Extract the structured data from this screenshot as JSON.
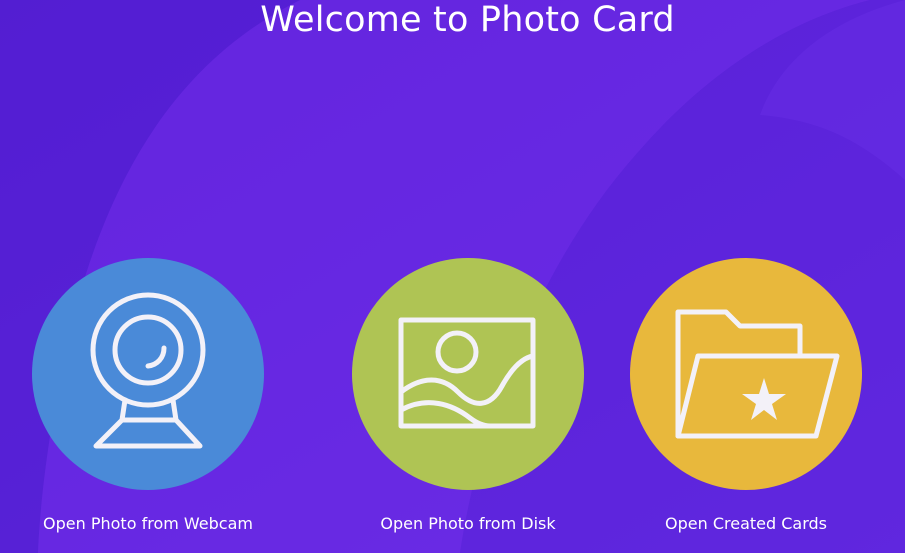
{
  "app": {
    "title": "Welcome to Photo Card"
  },
  "colors": {
    "background": "#5b22dd",
    "webcam": "#4a8ad8",
    "disk": "#afc454",
    "cards": "#e8b83c",
    "icon_stroke": "#f3f1f8"
  },
  "actions": [
    {
      "id": "webcam",
      "label": "Open Photo from Webcam",
      "icon": "webcam-icon"
    },
    {
      "id": "disk",
      "label": "Open Photo from Disk",
      "icon": "image-icon"
    },
    {
      "id": "cards",
      "label": "Open Created Cards",
      "icon": "star-folder-icon"
    }
  ]
}
